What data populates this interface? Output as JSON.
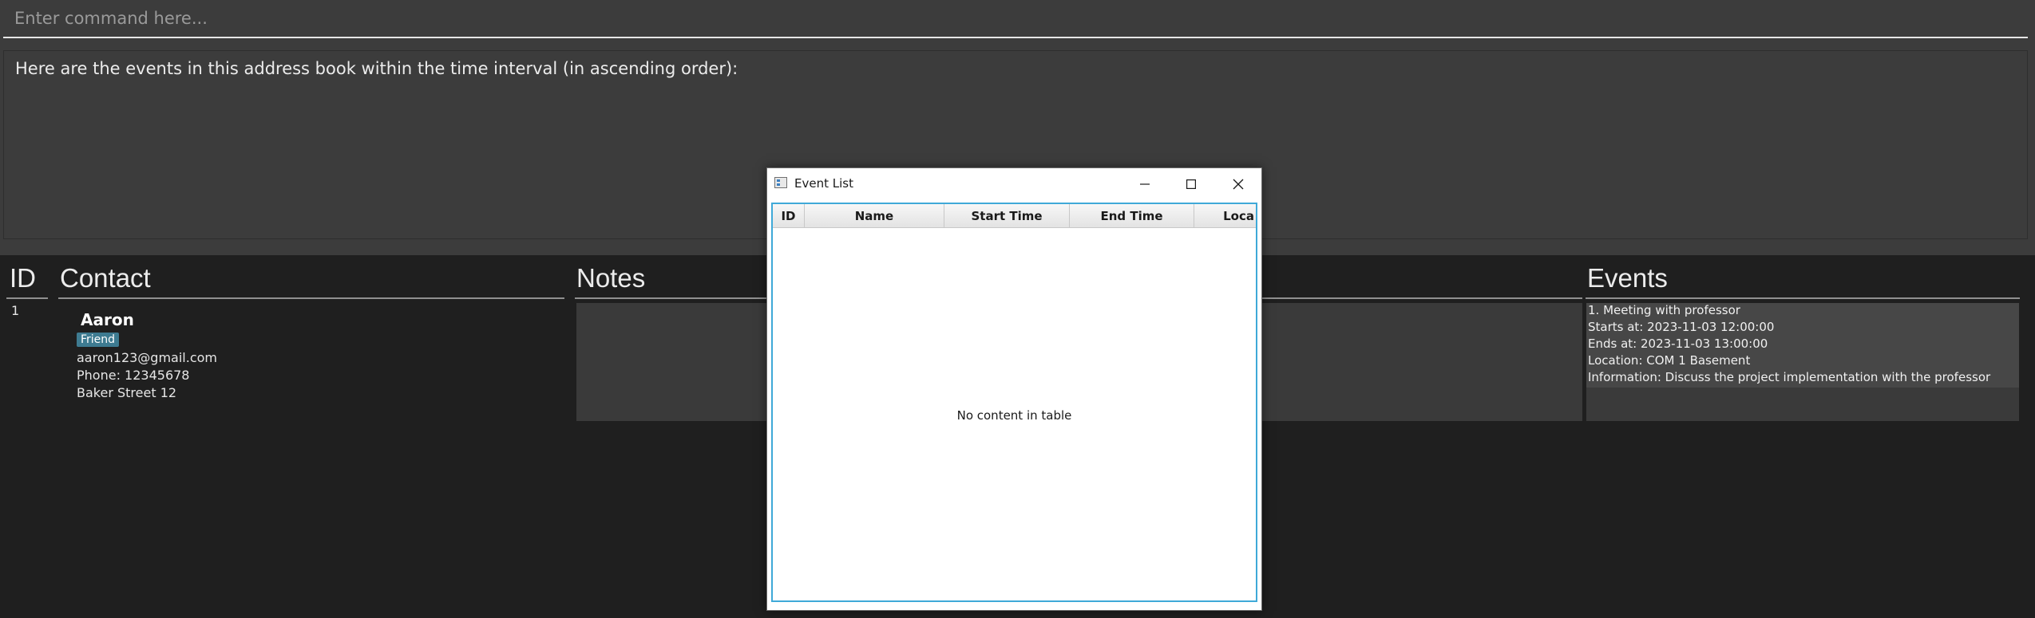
{
  "command_box": {
    "placeholder": "Enter command here..."
  },
  "result_display": {
    "text": "Here are the events in this address book within the time interval (in ascending order):"
  },
  "columns": {
    "id": "ID",
    "contact": "Contact",
    "notes": "Notes",
    "events": "Events"
  },
  "person": {
    "id": "1",
    "name": "Aaron",
    "tag": "Friend",
    "email": "aaron123@gmail.com",
    "phone": "Phone: 12345678",
    "address": "Baker Street 12"
  },
  "events": {
    "title": "1. Meeting with professor",
    "start": "Starts at: 2023-11-03 12:00:00",
    "end": "Ends at: 2023-11-03 13:00:00",
    "location": "Location: COM 1 Basement",
    "info": "Information: Discuss the project implementation with the professor"
  },
  "popup": {
    "title": "Event List",
    "icons": {
      "app": "window-app-icon",
      "minimize": "minimize-icon",
      "maximize": "maximize-icon",
      "close": "close-icon"
    },
    "table_headers": [
      "ID",
      "Name",
      "Start Time",
      "End Time",
      "Loca"
    ],
    "empty_text": "No content in table"
  }
}
